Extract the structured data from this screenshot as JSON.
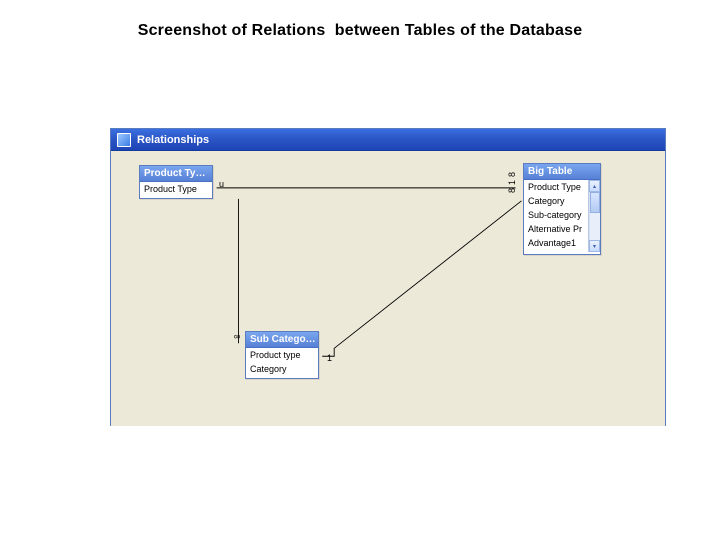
{
  "page_title": "Screenshot of Relations  between Tables of the Database",
  "window": {
    "title": "Relationships"
  },
  "tables": {
    "product_type": {
      "title": "Product Ty…",
      "fields": [
        "Product Type"
      ]
    },
    "sub_category": {
      "title": "Sub Catego…",
      "fields": [
        "Product type",
        "Category"
      ]
    },
    "big_table": {
      "title": "Big Table",
      "fields": [
        "Product Type",
        "Category",
        "Sub-category",
        "Alternative Pr",
        "Advantage1"
      ]
    }
  },
  "cardinality": {
    "pt_to_big_left": "u",
    "pt_to_big_right": "818",
    "pt_to_sub_top": "∞",
    "sub_to_big": "1"
  },
  "icons": {
    "up": "▴",
    "down": "▾"
  }
}
